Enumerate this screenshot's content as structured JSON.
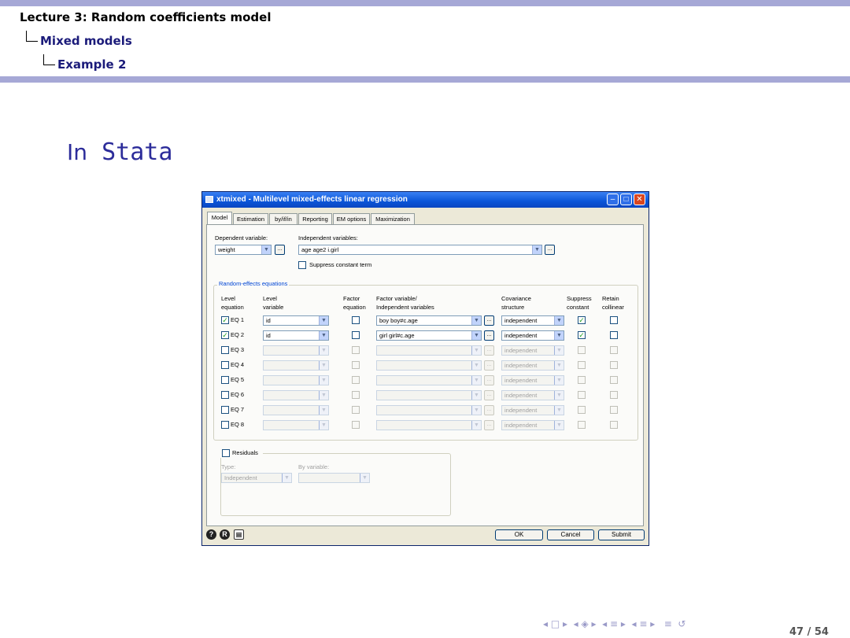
{
  "breadcrumb": {
    "lecture": "Lecture 3: Random coefficients model",
    "section": "Mixed models",
    "subsection": "Example 2"
  },
  "frame_title": {
    "first": "In",
    "rest": " Stata"
  },
  "dialog": {
    "title": "xtmixed - Multilevel mixed-effects linear regression",
    "tabs": [
      "Model",
      "Estimation",
      "by/if/in",
      "Reporting",
      "EM options",
      "Maximization"
    ],
    "dep_label": "Dependent variable:",
    "dep_value": "weight",
    "indep_label": "Independent variables:",
    "indep_value": "age age2 i.girl",
    "suppress_constant_term": "Suppress constant term",
    "re_group_label": "Random-effects equations",
    "headers": {
      "level_eq": [
        "Level",
        "equation"
      ],
      "level_var": [
        "Level",
        "variable"
      ],
      "factor_eq": [
        "Factor",
        "equation"
      ],
      "factor_vars": [
        "Factor variable/",
        "Independent variables"
      ],
      "covariance": [
        "Covariance",
        "structure"
      ],
      "suppress": [
        "Suppress",
        "constant"
      ],
      "retain": [
        "Retain",
        "collinear"
      ]
    },
    "equations": [
      {
        "label": "EQ 1",
        "enabled": true,
        "level": "id",
        "factor": "boy boy#c.age",
        "cov": "independent",
        "suppress": true,
        "retain": false
      },
      {
        "label": "EQ 2",
        "enabled": true,
        "level": "id",
        "factor": "girl girl#c.age",
        "cov": "independent",
        "suppress": true,
        "retain": false
      },
      {
        "label": "EQ 3",
        "enabled": false,
        "level": "",
        "factor": "",
        "cov": "independent",
        "suppress": false,
        "retain": false
      },
      {
        "label": "EQ 4",
        "enabled": false,
        "level": "",
        "factor": "",
        "cov": "independent",
        "suppress": false,
        "retain": false
      },
      {
        "label": "EQ 5",
        "enabled": false,
        "level": "",
        "factor": "",
        "cov": "independent",
        "suppress": false,
        "retain": false
      },
      {
        "label": "EQ 6",
        "enabled": false,
        "level": "",
        "factor": "",
        "cov": "independent",
        "suppress": false,
        "retain": false
      },
      {
        "label": "EQ 7",
        "enabled": false,
        "level": "",
        "factor": "",
        "cov": "independent",
        "suppress": false,
        "retain": false
      },
      {
        "label": "EQ 8",
        "enabled": false,
        "level": "",
        "factor": "",
        "cov": "independent",
        "suppress": false,
        "retain": false
      }
    ],
    "residuals": {
      "label": "Residuals",
      "type_label": "Type:",
      "type_value": "Independent",
      "by_label": "By variable:"
    },
    "buttons": {
      "ok": "OK",
      "cancel": "Cancel",
      "submit": "Submit"
    }
  },
  "nav": {
    "page": "47 / 54"
  }
}
